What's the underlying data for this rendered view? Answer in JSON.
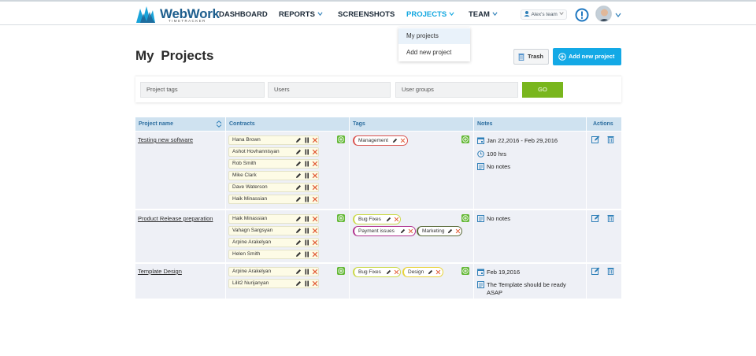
{
  "header": {
    "logo_text": "WebWork",
    "logo_sub": "TIMETRACKER",
    "nav": [
      {
        "label": "DASHBOARD"
      },
      {
        "label": "REPORTS"
      },
      {
        "label": "SCREENSHOTS"
      },
      {
        "label": "PROJECTS"
      },
      {
        "label": "TEAM"
      }
    ],
    "team_selector": "Alex's team"
  },
  "dropdown": {
    "items": [
      "My projects",
      "Add new project"
    ]
  },
  "page": {
    "title": "My Projects",
    "trash_label": "Trash",
    "add_label": "Add new project"
  },
  "filters": {
    "tags_placeholder": "Project tags",
    "users_placeholder": "Users",
    "groups_placeholder": "User groups",
    "go_label": "GO"
  },
  "table": {
    "headers": [
      "Project name",
      "Contracts",
      "Tags",
      "Notes",
      "Actions"
    ],
    "rows": [
      {
        "name": "Testing new software",
        "contracts": [
          "Hana Brown",
          "Ashot Hovhannisyan",
          "Rob Smith",
          "Mike Clark",
          "Dave Waterson",
          "Haik Minassian"
        ],
        "tags": [
          {
            "label": "Management",
            "color": "#d9534f"
          }
        ],
        "dates": "Jan 22,2016 - Feb 29,2016",
        "hours": "100 hrs",
        "note": "No notes"
      },
      {
        "name": "Product Release preparation",
        "contracts": [
          "Haik Minassian",
          "Vahagn Sargsyan",
          "Arpine Arakelyan",
          "Helen Smith"
        ],
        "tags": [
          {
            "label": "Bug Fixes",
            "color": "#cbd94a"
          },
          {
            "label": "Payment issues",
            "color": "#b0338f"
          },
          {
            "label": "Marketing",
            "color": "#5a6a3a"
          }
        ],
        "note": "No notes"
      },
      {
        "name": "Template Design",
        "contracts": [
          "Arpine Arakelyan",
          "Lilit2 Nurijanyan"
        ],
        "tags": [
          {
            "label": "Bug Fixes",
            "color": "#cbd94a"
          },
          {
            "label": "Design",
            "color": "#e8d33a"
          }
        ],
        "dates": "Feb 19,2016",
        "note": "The Template should be ready ASAP"
      }
    ]
  },
  "colors": {
    "accent": "#13a9e6",
    "go": "#79b61d",
    "header_bg": "#cfe2f0",
    "row_bg": "#eef0f6"
  }
}
